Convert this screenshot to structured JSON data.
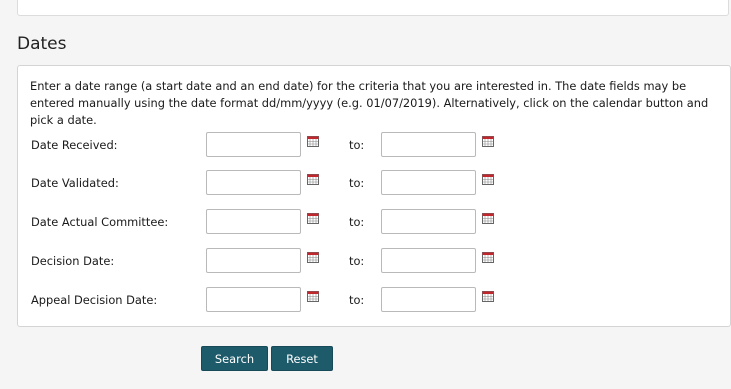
{
  "section": {
    "title": "Dates",
    "intro": "Enter a date range (a start date and an end date) for the criteria that you are interested in. The date fields may be entered manually using the date format dd/mm/yyyy (e.g. 01/07/2019). Alternatively, click on the calendar button and pick a date."
  },
  "rows": [
    {
      "label": "Date Received:",
      "to_label": "to:",
      "from_value": "",
      "to_value": ""
    },
    {
      "label": "Date Validated:",
      "to_label": "to:",
      "from_value": "",
      "to_value": ""
    },
    {
      "label": "Date Actual Committee:",
      "to_label": "to:",
      "from_value": "",
      "to_value": ""
    },
    {
      "label": "Decision Date:",
      "to_label": "to:",
      "from_value": "",
      "to_value": ""
    },
    {
      "label": "Appeal Decision Date:",
      "to_label": "to:",
      "from_value": "",
      "to_value": ""
    }
  ],
  "icons": {
    "calendar": "calendar-icon"
  },
  "buttons": {
    "search": "Search",
    "reset": "Reset"
  },
  "colors": {
    "button_bg": "#1d5a6a",
    "calendar_accent": "#c0282d"
  }
}
